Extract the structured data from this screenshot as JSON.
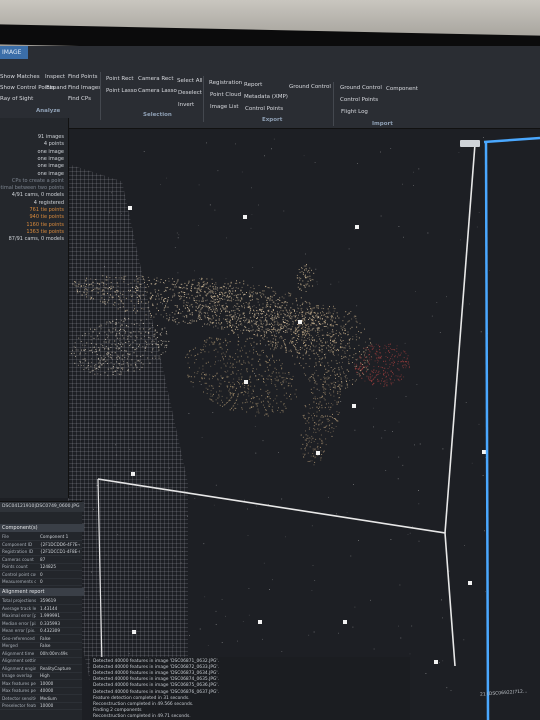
{
  "tab": {
    "label": "IMAGE"
  },
  "ribbon": {
    "groups": [
      {
        "title": "Analyze",
        "items": [
          "Show Matches",
          "Show Control Points",
          "Ray of Sight",
          "Inspect",
          "Expand",
          "Find Points",
          "Find Images",
          "Find CPs"
        ]
      },
      {
        "title": "Selection",
        "items": [
          "Point Rect",
          "Point Lasso",
          "Camera Rect",
          "Camera Lasso",
          "Select All",
          "Deselect",
          "Invert"
        ]
      },
      {
        "title": "Export",
        "items": [
          "Registration",
          "Point Cloud",
          "Image List",
          "Report",
          "Metadata (XMP)",
          "Control Points",
          "Ground Control"
        ]
      },
      {
        "title": "Import",
        "items": [
          "Ground Control",
          "Control Points",
          "Flight Log",
          "Component"
        ]
      }
    ]
  },
  "stats": [
    {
      "text": "91 images",
      "tone": "normal"
    },
    {
      "text": "4 points",
      "tone": "normal"
    },
    {
      "text": "one image",
      "tone": "normal"
    },
    {
      "text": "one image",
      "tone": "normal"
    },
    {
      "text": "one image",
      "tone": "normal"
    },
    {
      "text": "one image",
      "tone": "normal"
    },
    {
      "text": "CPs to create a point",
      "tone": "dim"
    },
    {
      "text": "optimal between two points",
      "tone": "dim"
    },
    {
      "text": "4/91 cams, 0 models",
      "tone": "normal"
    },
    {
      "text": "4 registered",
      "tone": "normal"
    },
    {
      "text": "761 tie points",
      "tone": "orange"
    },
    {
      "text": "940 tie points",
      "tone": "orange"
    },
    {
      "text": "1160 tie points",
      "tone": "orange"
    },
    {
      "text": "1363 tie points",
      "tone": "orange"
    },
    {
      "text": "87/91 cams, 0 models",
      "tone": "normal"
    }
  ],
  "panel": {
    "title": "DSC04121910|DSC0749_0600.JPG",
    "section1": "Component(s)",
    "rows": [
      [
        "File",
        "Component 1"
      ],
      [
        "Component ID",
        "{2F1DCDD6-4F7E-4E..."
      ],
      [
        "Registration ID",
        "{2F1DCCD1-4F8E-40..."
      ],
      [
        "Cameras count",
        "87"
      ],
      [
        "Points count",
        "124825"
      ],
      [
        "Control point count",
        "0"
      ],
      [
        "Measurements count",
        "0"
      ]
    ],
    "section2": "Alignment report",
    "rows2": [
      [
        "Total projections",
        "359619"
      ],
      [
        "Average track len...",
        "1.43144"
      ],
      [
        "Maximal error [pix...]",
        "1.999991"
      ],
      [
        "Median error [pix...]",
        "0.335993"
      ],
      [
        "Mean error [pix...]",
        "0.432309"
      ],
      [
        "Geo-referenced",
        "False"
      ],
      [
        "Merged",
        "False"
      ],
      [
        "Alignment time",
        "00h:00m:49s"
      ],
      [
        "Alignment settings",
        ""
      ],
      [
        "Alignment engine",
        "RealityCapture"
      ],
      [
        "Image overlap",
        "High"
      ],
      [
        "Max features per...",
        "10000"
      ],
      [
        "Max features per i...",
        "40000"
      ],
      [
        "Detector sensitivity",
        "Medium"
      ],
      [
        "Preselector features",
        "10000"
      ]
    ]
  },
  "log": [
    "Detected 40000 features in image 'DSC06871_0632.JPG'.",
    "Detected 40000 features in image 'DSC06872_0633.JPG'.",
    "Detected 40000 features in image 'DSC06873_0634.JPG'.",
    "Detected 40000 features in image 'DSC06874_0635.JPG'.",
    "Detected 40000 features in image 'DSC06875_0636.JPG'.",
    "Detected 40000 features in image 'DSC06876_0637.JPG'.",
    "Feature detection completed in 31 seconds.",
    "Reconstruction completed in 49.566 seconds.",
    "Finding 2 components",
    "Reconstruction completed in 49.71 seconds."
  ],
  "viewport": {
    "box_color": "#ffffff",
    "frustum_color": "#4aa8ff",
    "model_tint": "#b39a7a",
    "head_tint": "#8a3a3a"
  },
  "footnote": "21 (DSC06922)712...",
  "colors": {
    "accent": "#3b6ea8",
    "camera_selected": "#7ee06a"
  }
}
